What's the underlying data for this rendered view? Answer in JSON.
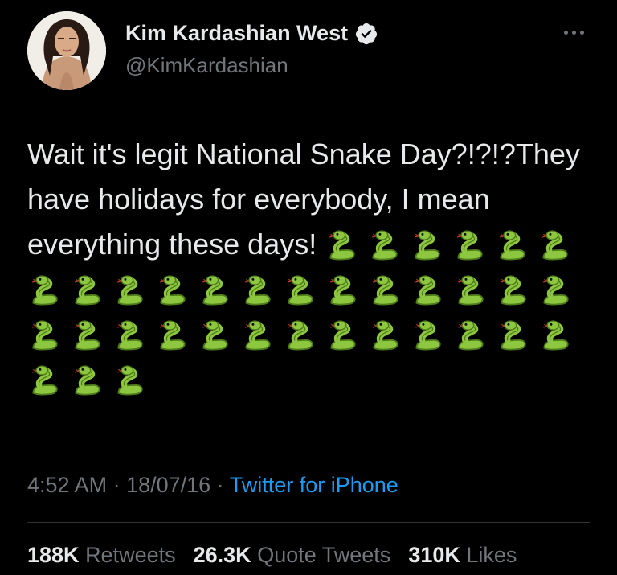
{
  "author": {
    "display_name": "Kim Kardashian West",
    "handle": "@KimKardashian",
    "verified": true,
    "avatar_icon": "profile-photo"
  },
  "tweet": {
    "text": "Wait it's legit National Snake Day?!?!?They have holidays for everybody, I mean everything these days!",
    "emoji_name": "snake-emoji",
    "emoji_count": 35
  },
  "meta": {
    "time": "4:52 AM",
    "separator": " · ",
    "date": "18/07/16",
    "source": "Twitter for iPhone"
  },
  "stats": {
    "retweets_count": "188K",
    "retweets_label": "Retweets",
    "quotes_count": "26.3K",
    "quotes_label": "Quote Tweets",
    "likes_count": "310K",
    "likes_label": "Likes"
  },
  "colors": {
    "background": "#000000",
    "text": "#e7e9ea",
    "secondary": "#71767b",
    "link": "#1d9bf0",
    "snake": "#8dc63f"
  }
}
